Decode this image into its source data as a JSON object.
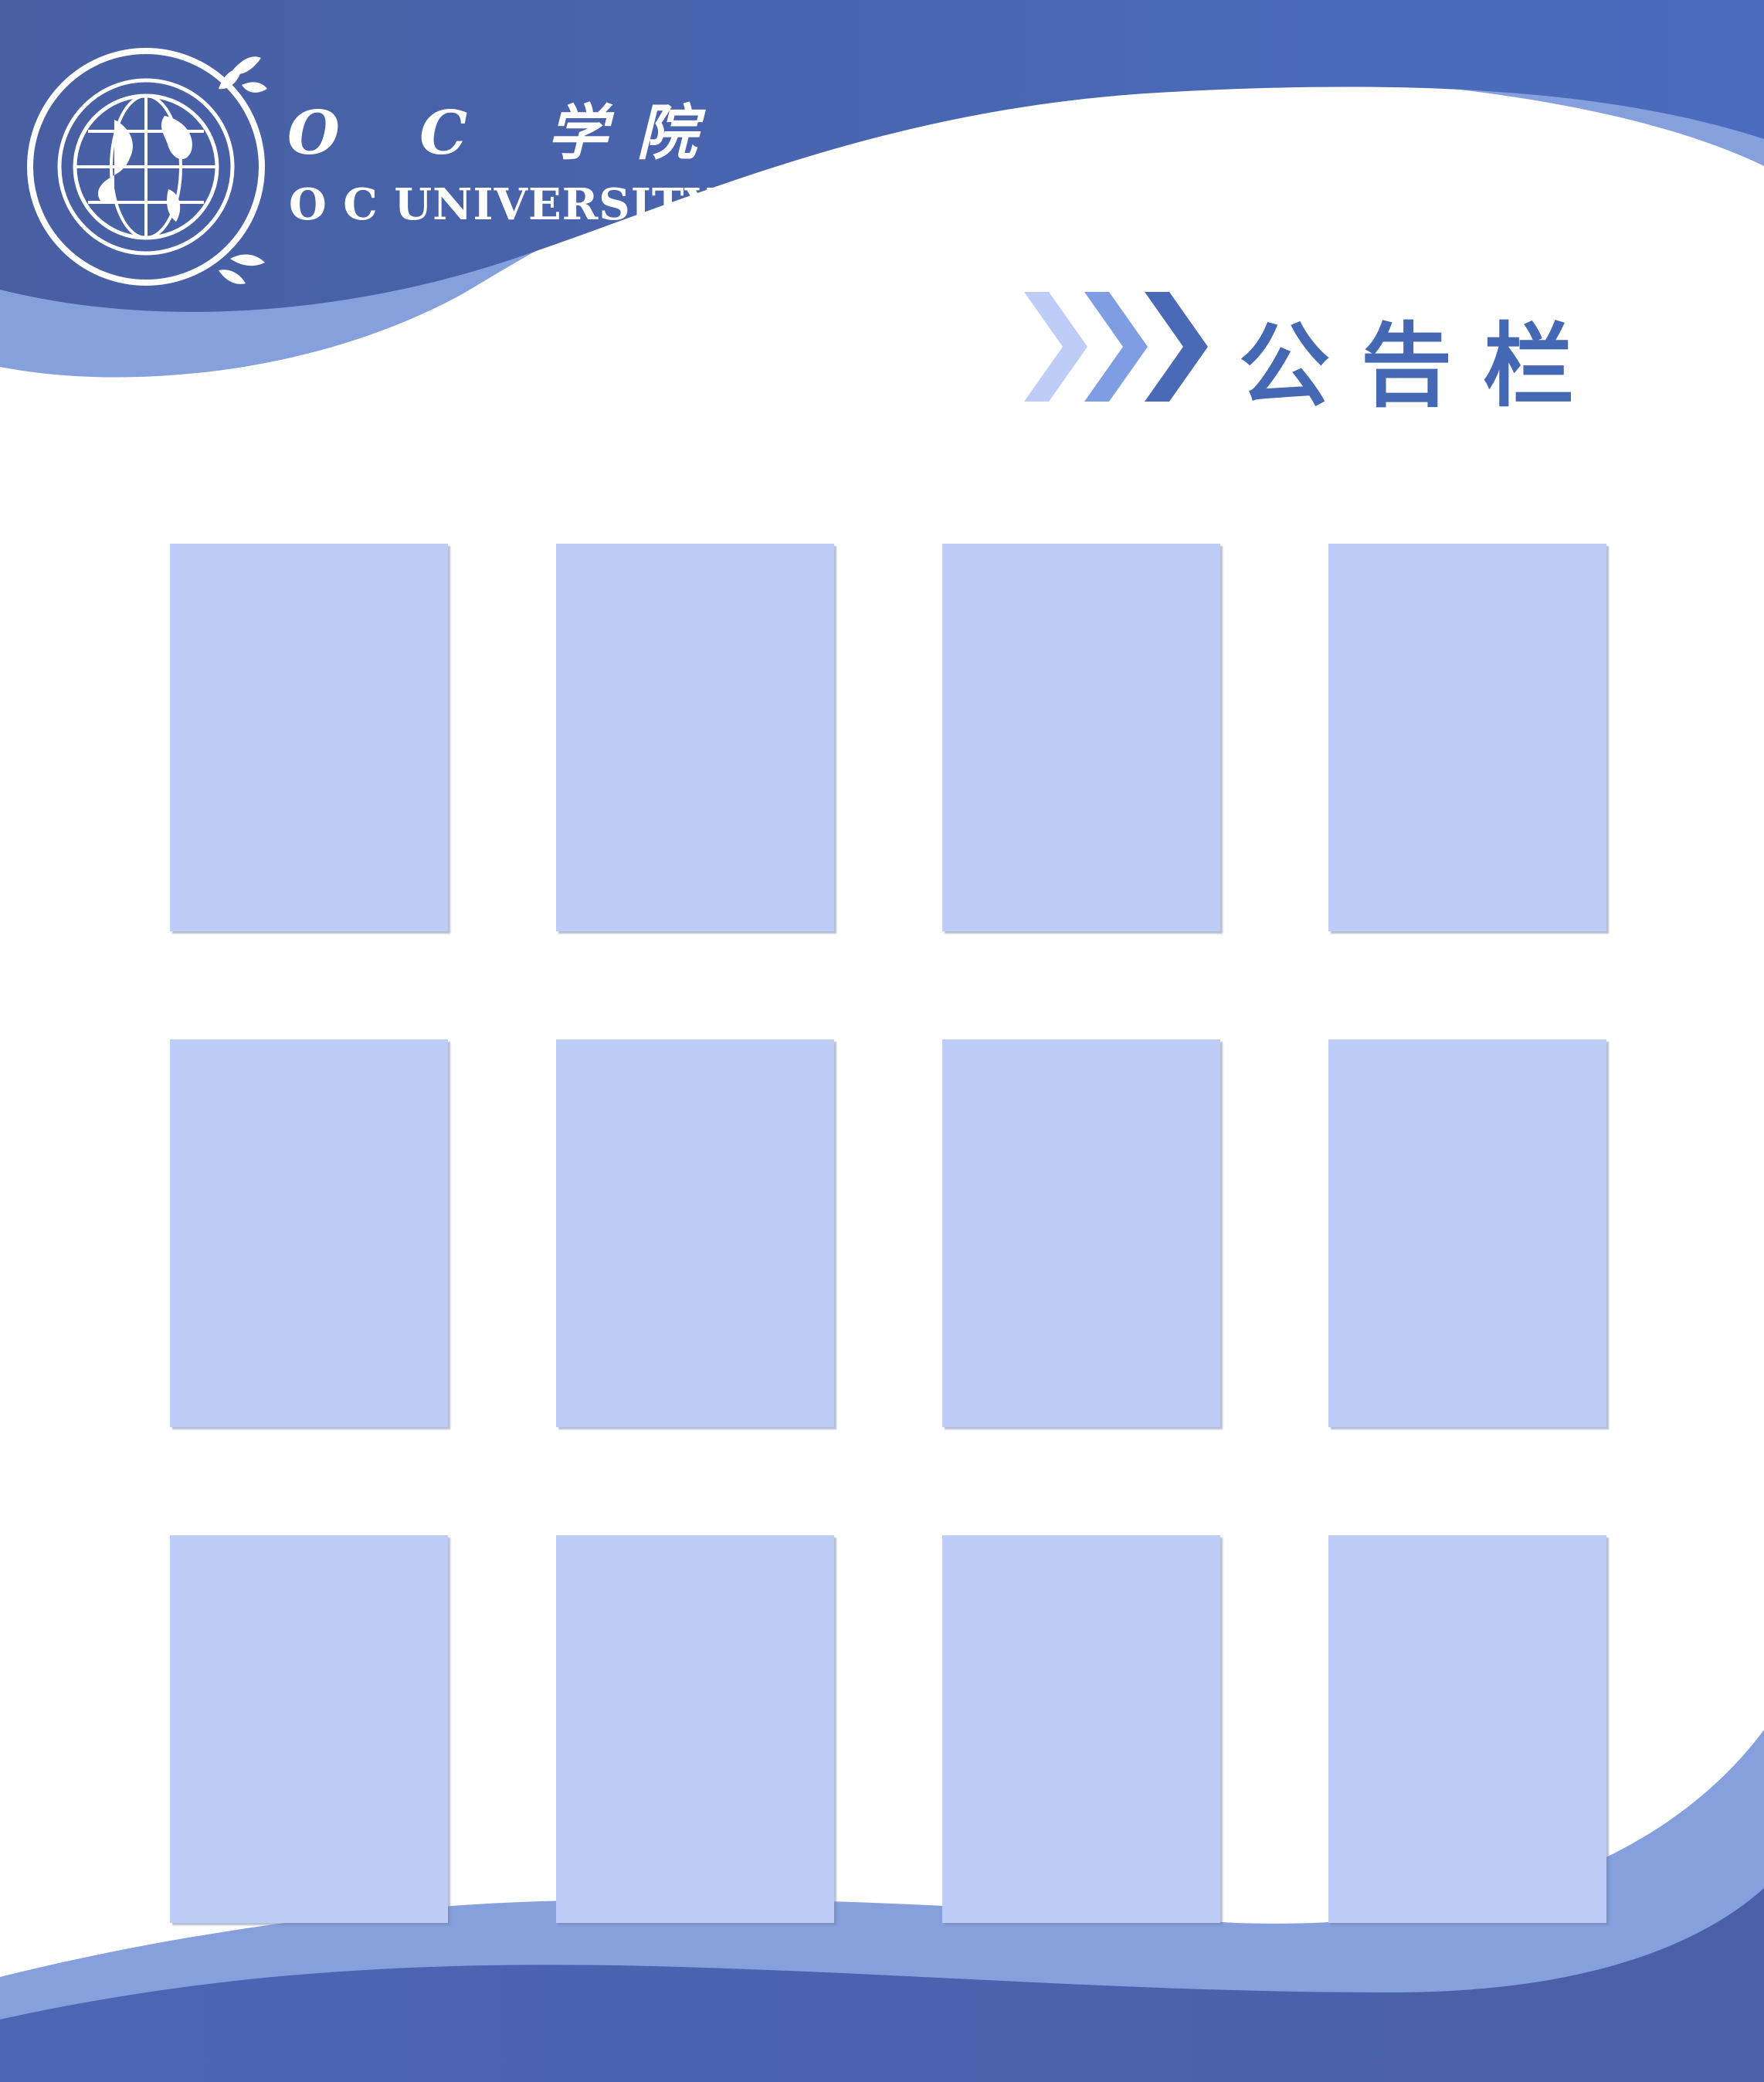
{
  "header": {
    "institution_name_cn": "O C 学院",
    "institution_name_en": "O C UNIVERSITY"
  },
  "emblem": {
    "icon": "globe-emblem-icon",
    "top_text": "OC学院",
    "bottom_text": "OC UNIVERSITY"
  },
  "board": {
    "title": "公告栏",
    "title_icon": "triple-chevron-right-icon"
  },
  "panels": {
    "rows": 3,
    "columns": 4,
    "count": 12
  },
  "colors": {
    "primary_blue": "#4a6ab8",
    "mid_blue": "#7f9de3",
    "panel_blue": "#bdcdf7",
    "title_blue": "#4468b4",
    "background": "#ffffff"
  }
}
